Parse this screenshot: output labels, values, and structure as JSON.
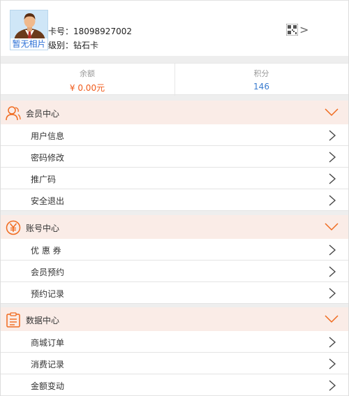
{
  "profile": {
    "avatar_caption": "暂无相片",
    "card_number": "卡号：18098927002",
    "level": "级别：钻石卡"
  },
  "stats": {
    "balance_label": "余额",
    "balance_value": "¥ 0.00元",
    "points_label": "积分",
    "points_value": "146"
  },
  "sections": [
    {
      "title": "会员中心",
      "icon": "person-icon",
      "items": [
        "用户信息",
        "密码修改",
        "推广码",
        "安全退出"
      ]
    },
    {
      "title": "账号中心",
      "icon": "yen-circle-icon",
      "items": [
        "优 惠 券",
        "会员预约",
        "预约记录"
      ]
    },
    {
      "title": "数据中心",
      "icon": "clipboard-list-icon",
      "items": [
        "商城订单",
        "消费记录",
        "金额变动"
      ]
    }
  ],
  "colors": {
    "accent_orange": "#f06a1e",
    "section_bg": "#faece7",
    "points_blue": "#3a7ccf",
    "money_orange": "#f05a1a"
  }
}
